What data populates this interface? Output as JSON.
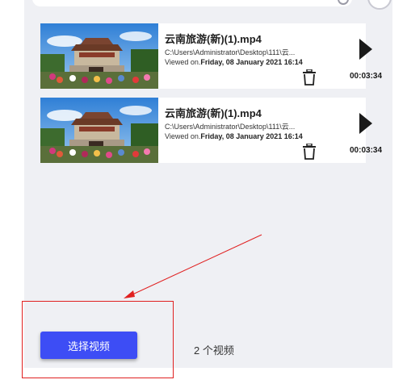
{
  "videos": [
    {
      "title": "云南旅游(新)(1).mp4",
      "path": "C:\\Users\\Administrator\\Desktop\\111\\云...",
      "viewed_prefix": "Viewed on.",
      "viewed_date": "Friday, 08 January 2021 16:14",
      "duration": "00:03:34"
    },
    {
      "title": "云南旅游(新)(1).mp4",
      "path": "C:\\Users\\Administrator\\Desktop\\111\\云...",
      "viewed_prefix": "Viewed on.",
      "viewed_date": "Friday, 08 January 2021 16:14",
      "duration": "00:03:34"
    }
  ],
  "footer": {
    "select_button_label": "选择视频",
    "video_count": "2 个视频"
  },
  "colors": {
    "accent": "#3d4df5",
    "panel_bg": "#eff0f4",
    "annotation": "#e02020"
  },
  "icons": {
    "play": "play-icon",
    "delete": "trash-icon",
    "search": "search-icon"
  }
}
